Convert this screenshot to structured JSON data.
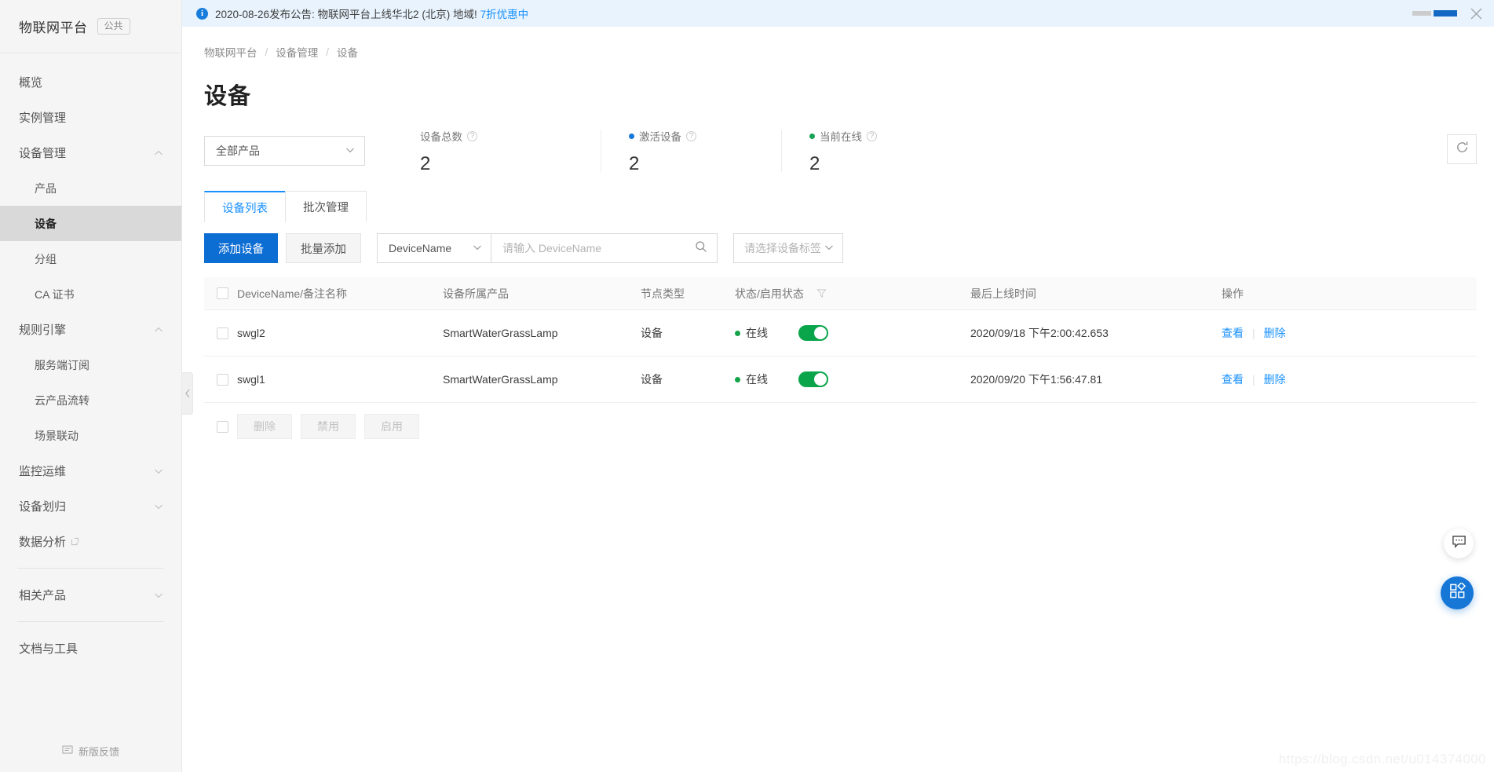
{
  "sidebar": {
    "brand": {
      "name": "物联网平台",
      "tag": "公共"
    },
    "items": [
      {
        "label": "概览",
        "type": "item"
      },
      {
        "label": "实例管理",
        "type": "item"
      },
      {
        "label": "设备管理",
        "type": "group",
        "caret": "chevron-up-icon"
      },
      {
        "label": "产品",
        "type": "sub"
      },
      {
        "label": "设备",
        "type": "sub",
        "active": true
      },
      {
        "label": "分组",
        "type": "sub"
      },
      {
        "label": "CA 证书",
        "type": "sub"
      },
      {
        "label": "规则引擎",
        "type": "group",
        "caret": "chevron-up-icon"
      },
      {
        "label": "服务端订阅",
        "type": "sub"
      },
      {
        "label": "云产品流转",
        "type": "sub"
      },
      {
        "label": "场景联动",
        "type": "sub"
      },
      {
        "label": "监控运维",
        "type": "group",
        "caret": "chevron-down-icon"
      },
      {
        "label": "设备划归",
        "type": "group",
        "caret": "chevron-down-icon"
      },
      {
        "label": "数据分析",
        "type": "item",
        "external": true
      },
      {
        "label": "相关产品",
        "type": "group",
        "caret": "chevron-down-icon"
      },
      {
        "label": "文档与工具",
        "type": "item"
      }
    ],
    "footer": {
      "label": "新版反馈",
      "icon": "feedback-icon"
    }
  },
  "notice": {
    "icon": "info-icon",
    "text": "2020-08-26发布公告: 物联网平台上线华北2 (北京) 地域!",
    "link": "7折优惠中",
    "close": "close-icon"
  },
  "breadcrumb": [
    {
      "label": "物联网平台"
    },
    {
      "label": "设备管理"
    },
    {
      "label": "设备"
    }
  ],
  "breadcrumb_separator": "/",
  "page": {
    "title": "设备"
  },
  "product_filter": {
    "value": "全部产品",
    "icon": "chevron-down-icon"
  },
  "stats": [
    {
      "label": "设备总数",
      "value": "2",
      "bullet": null,
      "help": "?"
    },
    {
      "label": "激活设备",
      "value": "2",
      "bullet": "#1677d6",
      "help": "?"
    },
    {
      "label": "当前在线",
      "value": "2",
      "bullet": "#18a254",
      "help": "?"
    }
  ],
  "refresh": {
    "icon": "refresh-icon"
  },
  "tabs": [
    {
      "label": "设备列表",
      "active": true
    },
    {
      "label": "批次管理",
      "active": false
    }
  ],
  "toolbar": {
    "add_device": "添加设备",
    "batch_add": "批量添加",
    "search_field": {
      "value": "DeviceName",
      "icon": "chevron-down-icon"
    },
    "search_input": {
      "value": "",
      "placeholder": "请输入 DeviceName",
      "icon": "search-icon"
    },
    "tag_select": {
      "value": "请选择设备标签",
      "icon": "chevron-down-icon"
    }
  },
  "table": {
    "columns": {
      "name": "DeviceName/备注名称",
      "product": "设备所属产品",
      "node": "节点类型",
      "status": "状态/启用状态",
      "status_filter_icon": "filter-icon",
      "time": "最后上线时间",
      "action": "操作"
    },
    "rows": [
      {
        "name": "swgl2",
        "product": "SmartWaterGrassLamp",
        "node": "设备",
        "status": "在线",
        "enabled": true,
        "time": "2020/09/18 下午2:00:42.653",
        "actions": [
          "查看",
          "删除"
        ]
      },
      {
        "name": "swgl1",
        "product": "SmartWaterGrassLamp",
        "node": "设备",
        "status": "在线",
        "enabled": true,
        "time": "2020/09/20 下午1:56:47.81",
        "actions": [
          "查看",
          "删除"
        ]
      }
    ],
    "batch_actions": [
      {
        "label": "删除",
        "disabled": true
      },
      {
        "label": "禁用",
        "disabled": true
      },
      {
        "label": "启用",
        "disabled": true
      }
    ]
  },
  "floating": {
    "chat": "chat-icon",
    "apps": "apps-grid-icon"
  },
  "watermark": "https://blog.csdn.net/u014374000",
  "colors": {
    "primary": "#0c6dd3",
    "link": "#1890ff",
    "online": "#15a34a",
    "toggle_on": "#0aa54b",
    "notice_bg": "#e8f3fd"
  }
}
